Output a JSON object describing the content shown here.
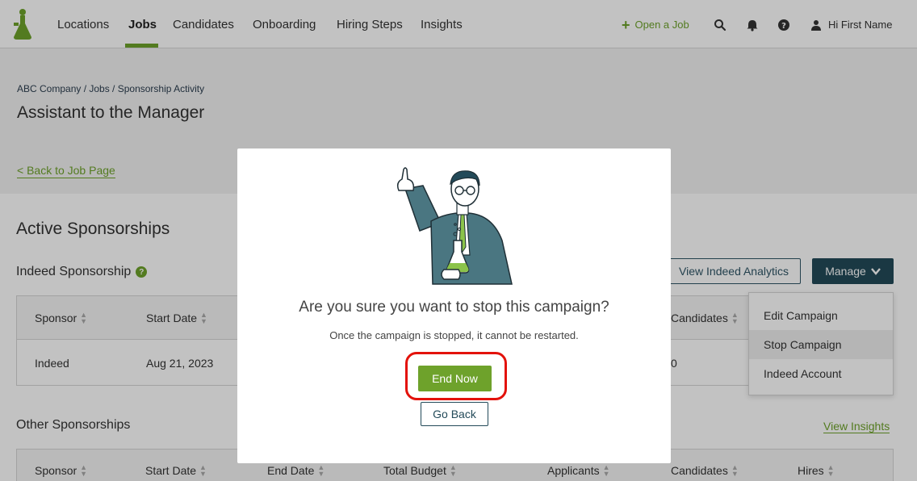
{
  "nav": {
    "items": [
      "Locations",
      "Jobs",
      "Candidates",
      "Onboarding",
      "Hiring Steps",
      "Insights"
    ],
    "active": "Jobs",
    "open_job": "Open a Job",
    "greeting": "Hi First Name",
    "icons": [
      "search-icon",
      "bell-icon",
      "help-icon",
      "user-icon"
    ],
    "accent": "#6ea22b"
  },
  "header": {
    "breadcrumb": "ABC Company / Jobs / Sponsorship Activity",
    "title": "Assistant to the Manager",
    "back_link": "< Back to Job Page"
  },
  "active_section": {
    "title": "Active Sponsorships",
    "indeed_title": "Indeed Sponsorship",
    "view_analytics": "View Indeed Analytics",
    "manage": "Manage",
    "columns": [
      "Sponsor",
      "Start Date",
      "Candidates"
    ],
    "row": {
      "sponsor": "Indeed",
      "start_date": "Aug 21, 2023",
      "candidates": "0"
    },
    "menu": [
      "Edit Campaign",
      "Stop Campaign",
      "Indeed Account"
    ],
    "menu_hovered": "Stop Campaign"
  },
  "other_section": {
    "title": "Other Sponsorships",
    "view_insights": "View Insights",
    "columns": [
      "Sponsor",
      "Start Date",
      "End Date",
      "Total Budget",
      "Applicants",
      "Candidates",
      "Hires"
    ]
  },
  "modal": {
    "title": "Are you sure you want to stop this campaign?",
    "subtitle": "Once the campaign is stopped, it cannot be restarted.",
    "confirm": "End Now",
    "cancel": "Go Back",
    "highlight_color": "#e3120b"
  }
}
